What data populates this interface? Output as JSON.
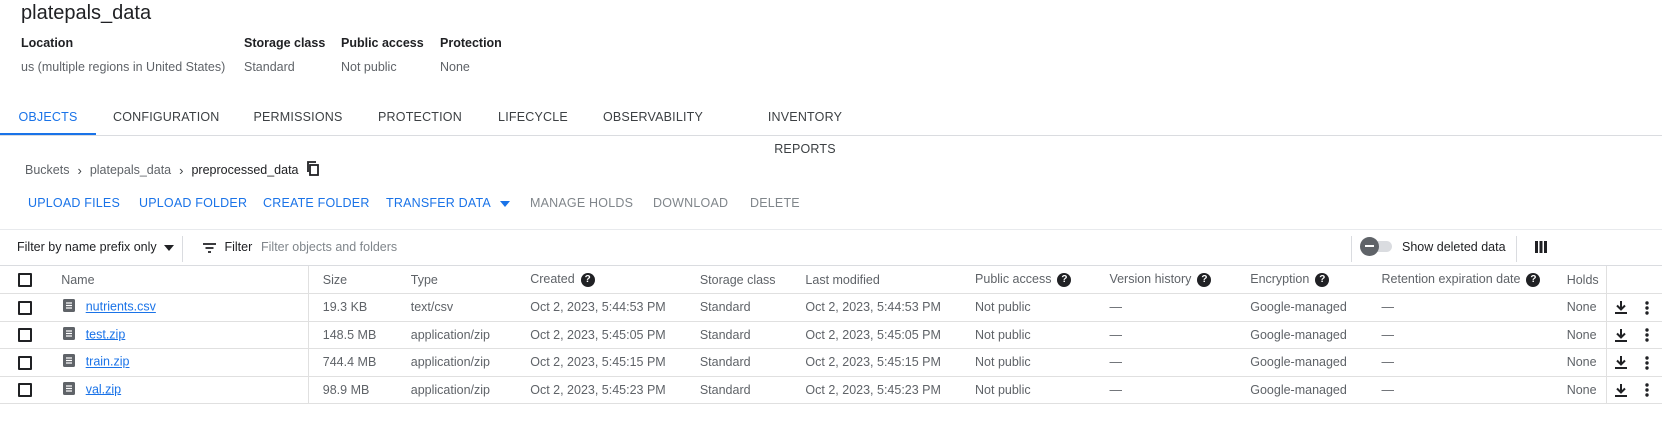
{
  "bucket": {
    "title": "platepals_data",
    "meta": [
      {
        "label": "Location",
        "value": "us (multiple regions in United States)"
      },
      {
        "label": "Storage class",
        "value": "Standard"
      },
      {
        "label": "Public access",
        "value": "Not public"
      },
      {
        "label": "Protection",
        "value": "None"
      }
    ]
  },
  "tabs": [
    {
      "label": "OBJECTS",
      "active": true
    },
    {
      "label": "CONFIGURATION"
    },
    {
      "label": "PERMISSIONS"
    },
    {
      "label": "PROTECTION"
    },
    {
      "label": "LIFECYCLE"
    },
    {
      "label": "OBSERVABILITY"
    },
    {
      "label": "INVENTORY REPORTS"
    }
  ],
  "breadcrumb": [
    "Buckets",
    "platepals_data",
    "preprocessed_data"
  ],
  "actions": [
    {
      "label": "UPLOAD FILES",
      "enabled": true
    },
    {
      "label": "UPLOAD FOLDER",
      "enabled": true
    },
    {
      "label": "CREATE FOLDER",
      "enabled": true
    },
    {
      "label": "TRANSFER DATA",
      "enabled": true
    },
    {
      "label": "MANAGE HOLDS",
      "enabled": false
    },
    {
      "label": "DOWNLOAD",
      "enabled": false
    },
    {
      "label": "DELETE",
      "enabled": false
    }
  ],
  "filter": {
    "prefix_label": "Filter by name prefix only",
    "filter_label": "Filter",
    "placeholder": "Filter objects and folders",
    "show_deleted_label": "Show deleted data"
  },
  "columns": [
    "Name",
    "Size",
    "Type",
    "Created",
    "Storage class",
    "Last modified",
    "Public access",
    "Version history",
    "Encryption",
    "Retention expiration date",
    "Holds"
  ],
  "rows": [
    {
      "name": "nutrients.csv",
      "size": "19.3 KB",
      "type": "text/csv",
      "created": "Oct 2, 2023, 5:44:53 PM",
      "storage_class": "Standard",
      "modified": "Oct 2, 2023, 5:44:53 PM",
      "public": "Not public",
      "version": "—",
      "encryption": "Google-managed",
      "retention": "—",
      "holds": "None"
    },
    {
      "name": "test.zip",
      "size": "148.5 MB",
      "type": "application/zip",
      "created": "Oct 2, 2023, 5:45:05 PM",
      "storage_class": "Standard",
      "modified": "Oct 2, 2023, 5:45:05 PM",
      "public": "Not public",
      "version": "—",
      "encryption": "Google-managed",
      "retention": "—",
      "holds": "None"
    },
    {
      "name": "train.zip",
      "size": "744.4 MB",
      "type": "application/zip",
      "created": "Oct 2, 2023, 5:45:15 PM",
      "storage_class": "Standard",
      "modified": "Oct 2, 2023, 5:45:15 PM",
      "public": "Not public",
      "version": "—",
      "encryption": "Google-managed",
      "retention": "—",
      "holds": "None"
    },
    {
      "name": "val.zip",
      "size": "98.9 MB",
      "type": "application/zip",
      "created": "Oct 2, 2023, 5:45:23 PM",
      "storage_class": "Standard",
      "modified": "Oct 2, 2023, 5:45:23 PM",
      "public": "Not public",
      "version": "—",
      "encryption": "Google-managed",
      "retention": "—",
      "holds": "None"
    }
  ],
  "colors": {
    "accent": "#1a73e8",
    "text": "#202124",
    "muted": "#5f6368"
  }
}
